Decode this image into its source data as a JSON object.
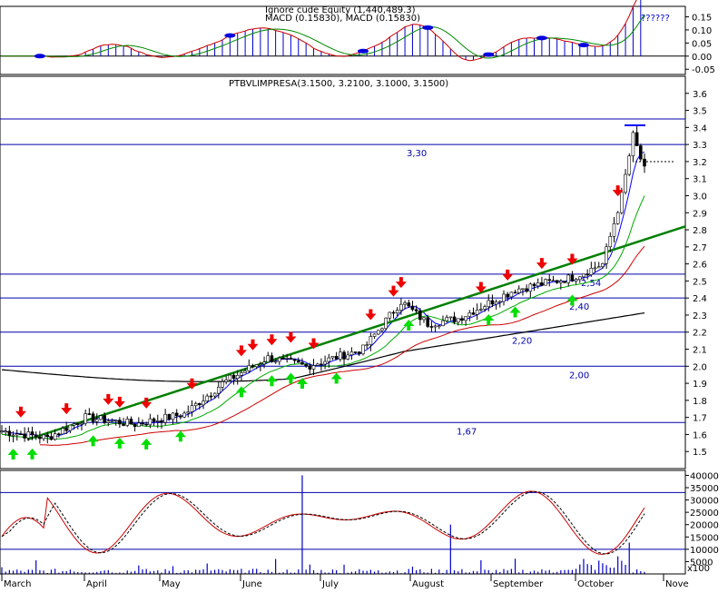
{
  "chart_data": [
    {
      "type": "bar",
      "panel": "macd",
      "title_line1": "Ignore cude Equity (1,440,489.3)",
      "title_line2": "MACD (0.15830), MACD (0.15830)",
      "annotation": "??????",
      "ylim": [
        -0.07,
        0.19
      ],
      "yticks": [
        "0.15",
        "0.10",
        "0.05",
        "0.00",
        "-0.05"
      ],
      "ytick_values": [
        0.15,
        0.1,
        0.05,
        0.0,
        -0.05
      ],
      "colors": {
        "histogram": "#0000cc",
        "macd_line": "#cc0000",
        "signal_line": "#008800",
        "dots": "#0000dd"
      },
      "grid": false
    },
    {
      "type": "candlestick",
      "panel": "price",
      "title": "PTBVLIMPRESA(3.1500, 3.2100, 3.1000, 3.1500)",
      "ylim": [
        1.4,
        3.7
      ],
      "yticks": [
        "3.6",
        "3.5",
        "3.4",
        "3.3",
        "3.2",
        "3.1",
        "3.0",
        "2.9",
        "2.8",
        "2.7",
        "2.6",
        "2.5",
        "2.4",
        "2.3",
        "2.2",
        "2.1",
        "2.0",
        "1.9",
        "1.8",
        "1.7",
        "1.6",
        "1.5"
      ],
      "ytick_values": [
        3.6,
        3.5,
        3.4,
        3.3,
        3.2,
        3.1,
        3.0,
        2.9,
        2.8,
        2.7,
        2.6,
        2.5,
        2.4,
        2.3,
        2.2,
        2.1,
        2.0,
        1.9,
        1.8,
        1.7,
        1.6,
        1.5
      ],
      "horizontal_levels": [
        {
          "value": 3.45,
          "label": ""
        },
        {
          "value": 3.3,
          "label": "3,30"
        },
        {
          "value": 2.54,
          "label": "2,54"
        },
        {
          "value": 2.4,
          "label": "2,40"
        },
        {
          "value": 2.2,
          "label": "2,20"
        },
        {
          "value": 2.0,
          "label": "2,00"
        },
        {
          "value": 1.67,
          "label": "1,67"
        }
      ],
      "trendline": {
        "from": [
          "March",
          1.57
        ],
        "to": [
          "November",
          2.82
        ],
        "color": "#008000"
      },
      "series": [
        {
          "name": "close",
          "x_months": [
            "March",
            "April",
            "May",
            "June",
            "July",
            "August",
            "September",
            "October"
          ],
          "values": [
            1.6,
            1.7,
            1.9,
            2.05,
            2.15,
            2.25,
            2.5,
            3.15
          ]
        }
      ],
      "colors": {
        "up_candle": "#ffffff",
        "down_candle": "#000000",
        "sell_arrow": "#ee0000",
        "buy_arrow": "#00dd00",
        "ma_short": "#0000ff",
        "ma_mid": "#cc0000",
        "ma_long": "#000000",
        "ma_green": "#00aa00"
      },
      "grid": false
    },
    {
      "type": "line",
      "panel": "volume_stochastic",
      "yticks": [
        "40000",
        "35000",
        "30000",
        "25000",
        "20000",
        "15000",
        "10000",
        "5000"
      ],
      "ytick_values": [
        40000,
        35000,
        30000,
        25000,
        20000,
        15000,
        10000,
        5000
      ],
      "ylim": [
        0,
        42000
      ],
      "unit_label": "x100",
      "levels": [
        33000,
        10000
      ],
      "colors": {
        "oscillator": "#cc0000",
        "signal": "#000000",
        "volume": "#0000cc"
      },
      "grid": false
    }
  ],
  "xaxis": {
    "months": [
      "March",
      "April",
      "May",
      "June",
      "July",
      "August",
      "September",
      "October",
      "Nove"
    ]
  }
}
